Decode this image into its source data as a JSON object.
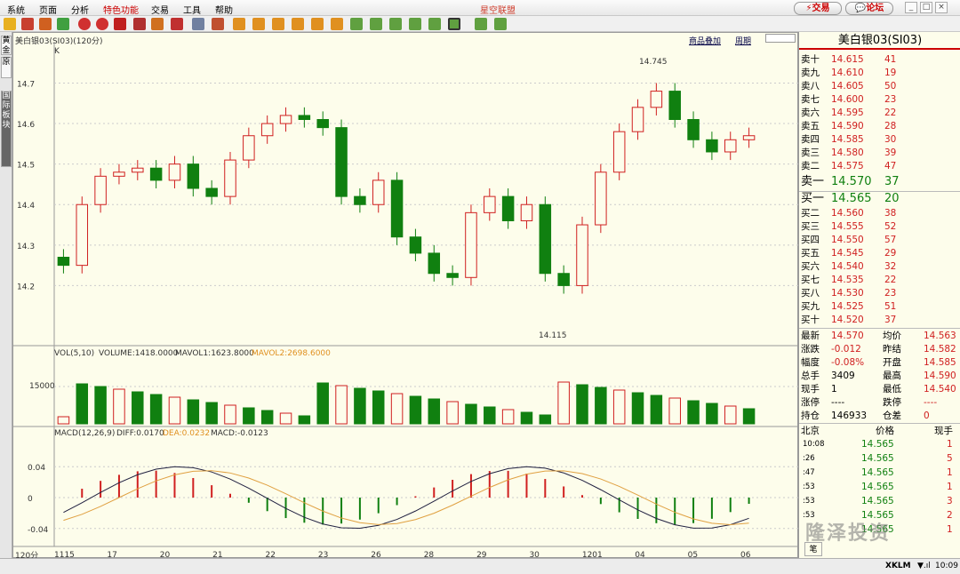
{
  "menu": {
    "items": [
      "系统",
      "页面",
      "分析",
      "特色功能",
      "交易",
      "工具",
      "帮助"
    ],
    "title": "星空联盟",
    "trade_btn": "交易",
    "forum_btn": "论坛"
  },
  "left_tabs": [
    "黄金",
    "原",
    "国际板块"
  ],
  "chart": {
    "header": "美白银03(SI03)(120分)",
    "k_label": "K",
    "top_links": [
      "商品叠加",
      "周期"
    ],
    "vol_header": {
      "vol": "VOL(5,10)",
      "volume": "VOLUME:1418.0000",
      "mavol1": "MAVOL1:1623.8000",
      "mavol2": "MAVOL2:2698.6000"
    },
    "macd_header": {
      "macd": "MACD(12,26,9)",
      "diff": "DIFF:0.0170",
      "dea": "DEA:0.0232",
      "macdv": "MACD:-0.0123"
    },
    "price_ticks": [
      "14.7",
      "14.6",
      "14.5",
      "14.4",
      "14.3",
      "14.2"
    ],
    "vol_tick": "15000",
    "macd_ticks": [
      "0.04",
      "0",
      "-0.04"
    ],
    "x_labels": [
      "1115",
      "17",
      "20",
      "21",
      "22",
      "23",
      "26",
      "28",
      "29",
      "30",
      "1201",
      "04",
      "05",
      "06"
    ],
    "period_label": "120分",
    "high_mark": "14.745",
    "low_mark": "14.115",
    "colors": {
      "up": "#d02020",
      "down": "#108010",
      "diff": "#202040",
      "dea": "#e0a040",
      "bg": "#fdfdeb"
    }
  },
  "chart_data": {
    "type": "candlestick",
    "title": "美白银03(SI03)(120分)",
    "x": [
      "1115",
      "17",
      "20",
      "21",
      "22",
      "23",
      "26",
      "28",
      "29",
      "30",
      "1201",
      "04",
      "05",
      "06"
    ],
    "ylim": [
      14.1,
      14.78
    ],
    "close": [
      14.25,
      14.4,
      14.47,
      14.48,
      14.49,
      14.46,
      14.5,
      14.44,
      14.42,
      14.51,
      14.57,
      14.6,
      14.62,
      14.61,
      14.59,
      14.42,
      14.4,
      14.46,
      14.32,
      14.28,
      14.23,
      14.22,
      14.38,
      14.42,
      14.36,
      14.4,
      14.23,
      14.2,
      14.35,
      14.48,
      14.58,
      14.64,
      14.68,
      14.61,
      14.56,
      14.53,
      14.56,
      14.57
    ]
  },
  "quote": {
    "title": "美白银03(SI03)",
    "asks": [
      [
        "卖十",
        "14.615",
        "41"
      ],
      [
        "卖九",
        "14.610",
        "19"
      ],
      [
        "卖八",
        "14.605",
        "50"
      ],
      [
        "卖七",
        "14.600",
        "23"
      ],
      [
        "卖六",
        "14.595",
        "22"
      ],
      [
        "卖五",
        "14.590",
        "28"
      ],
      [
        "卖四",
        "14.585",
        "30"
      ],
      [
        "卖三",
        "14.580",
        "39"
      ],
      [
        "卖二",
        "14.575",
        "47"
      ]
    ],
    "ask1": [
      "卖一",
      "14.570",
      "37"
    ],
    "bid1": [
      "买一",
      "14.565",
      "20"
    ],
    "bids": [
      [
        "买二",
        "14.560",
        "38"
      ],
      [
        "买三",
        "14.555",
        "52"
      ],
      [
        "买四",
        "14.550",
        "57"
      ],
      [
        "买五",
        "14.545",
        "29"
      ],
      [
        "买六",
        "14.540",
        "32"
      ],
      [
        "买七",
        "14.535",
        "22"
      ],
      [
        "买八",
        "14.530",
        "23"
      ],
      [
        "买九",
        "14.525",
        "51"
      ],
      [
        "买十",
        "14.520",
        "37"
      ]
    ],
    "stats": [
      [
        "最新",
        "14.570",
        "均价",
        "14.563"
      ],
      [
        "涨跌",
        "-0.012",
        "昨结",
        "14.582"
      ],
      [
        "幅度",
        "-0.08%",
        "开盘",
        "14.585"
      ],
      [
        "总手",
        "3409",
        "最高",
        "14.590"
      ],
      [
        "现手",
        "1",
        "最低",
        "14.540"
      ],
      [
        "涨停",
        "----",
        "跌停",
        "----"
      ],
      [
        "持仓",
        "146933",
        "仓差",
        "0"
      ]
    ],
    "ticks_header": [
      "北京",
      "价格",
      "现手"
    ],
    "ticks": [
      [
        "10:08",
        "14.565",
        "1"
      ],
      [
        ":26",
        "14.565",
        "5"
      ],
      [
        ":47",
        "14.565",
        "1"
      ],
      [
        ":53",
        "14.565",
        "1"
      ],
      [
        ":53",
        "14.565",
        "3"
      ],
      [
        ":53",
        "14.565",
        "2"
      ],
      [
        "",
        "14.565",
        "1"
      ]
    ]
  },
  "status": {
    "left": "笔",
    "right_brand": "XKLM",
    "time": "10:09",
    "watermark": "隆泽投资"
  }
}
